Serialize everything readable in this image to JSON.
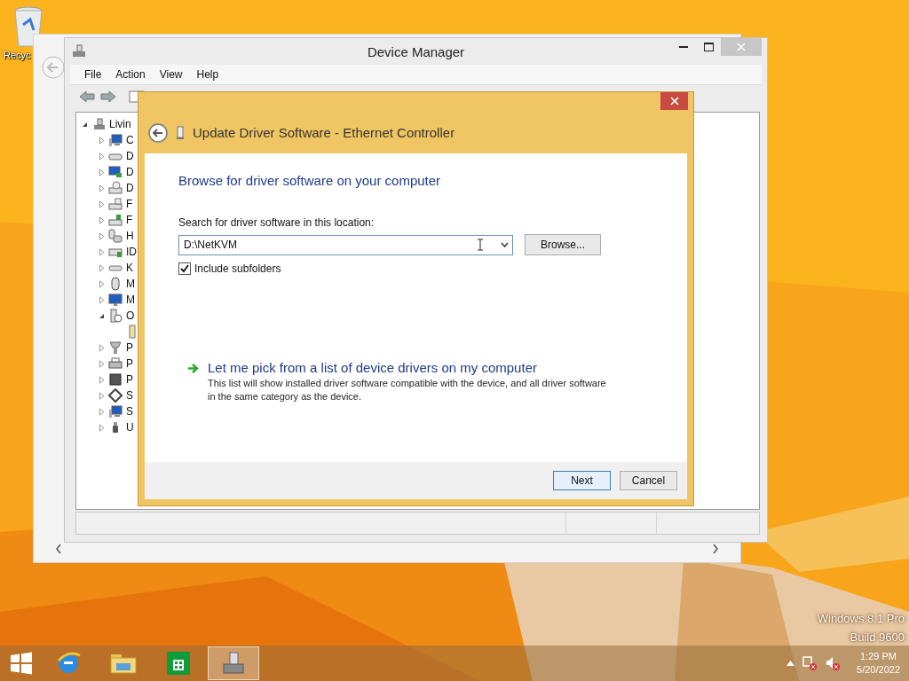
{
  "desktop": {
    "icons": [
      {
        "label": "Recyc"
      }
    ]
  },
  "device_manager": {
    "title": "Device Manager",
    "menu": [
      "File",
      "Action",
      "View",
      "Help"
    ],
    "tree": [
      {
        "label": "Livin",
        "kind": "host",
        "expanded": true,
        "children": [
          {
            "label": "C",
            "kind": "computer",
            "expanded": false
          },
          {
            "label": "D",
            "kind": "drive",
            "expanded": false
          },
          {
            "label": "D",
            "kind": "display",
            "expanded": false
          },
          {
            "label": "D",
            "kind": "dvd",
            "expanded": false
          },
          {
            "label": "F",
            "kind": "floppy",
            "expanded": false
          },
          {
            "label": "F",
            "kind": "controller",
            "expanded": false
          },
          {
            "label": "H",
            "kind": "hid",
            "expanded": false
          },
          {
            "label": "ID",
            "kind": "ide",
            "expanded": false
          },
          {
            "label": "K",
            "kind": "keyboard",
            "expanded": false
          },
          {
            "label": "M",
            "kind": "mouse",
            "expanded": false
          },
          {
            "label": "M",
            "kind": "monitor",
            "expanded": false
          },
          {
            "label": "O",
            "kind": "unknown",
            "expanded": true,
            "children": [
              {
                "kind": "adapter"
              }
            ]
          },
          {
            "label": "P",
            "kind": "port",
            "expanded": false
          },
          {
            "label": "P",
            "kind": "printer",
            "expanded": false
          },
          {
            "label": "P",
            "kind": "processor",
            "expanded": false
          },
          {
            "label": "S",
            "kind": "storage",
            "expanded": false
          },
          {
            "label": "S",
            "kind": "computer",
            "expanded": false
          },
          {
            "label": "U",
            "kind": "usb",
            "expanded": false
          }
        ]
      }
    ]
  },
  "dialog": {
    "title": "Update Driver Software - Ethernet Controller",
    "heading": "Browse for driver software on your computer",
    "location_label": "Search for driver software in this location:",
    "location_value": "D:\\NetKVM",
    "browse_button": "Browse...",
    "include_subfolders": {
      "label": "Include subfolders",
      "checked": true
    },
    "pick_link": {
      "label": "Let me pick from a list of device drivers on my computer",
      "description": "This list will show installed driver software compatible with the device, and all driver software in the same category as the device."
    },
    "buttons": [
      {
        "label": "Next",
        "default": true
      },
      {
        "label": "Cancel",
        "default": false
      }
    ]
  },
  "watermark": [
    "Windows 8.1 Pro",
    "Build 9600"
  ],
  "taskbar": {
    "apps": [
      {
        "kind": "browser",
        "selected": false
      },
      {
        "kind": "folder",
        "selected": false
      },
      {
        "kind": "store",
        "selected": false
      },
      {
        "kind": "devices",
        "selected": true
      }
    ],
    "clock": {
      "time": "1:29 PM",
      "date": "5/20/2022"
    }
  }
}
